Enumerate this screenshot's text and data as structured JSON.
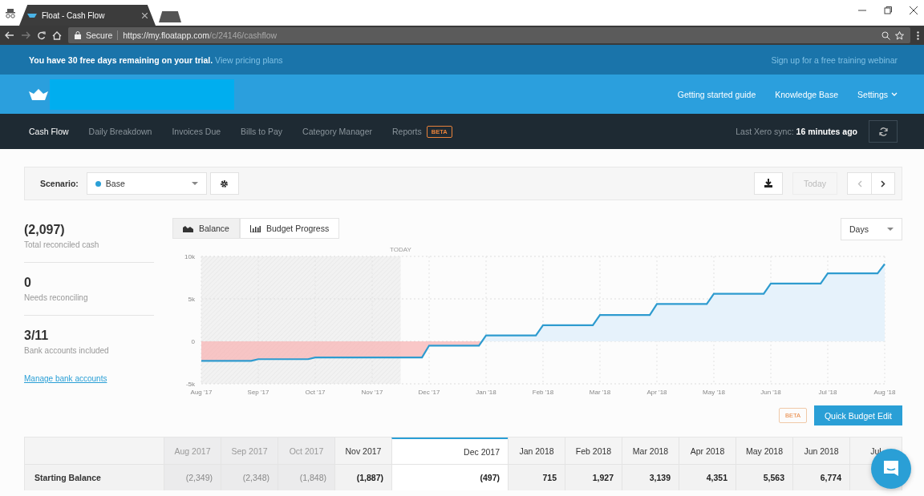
{
  "browser": {
    "tab_title": "Float - Cash Flow",
    "secure_label": "Secure",
    "url_host": "https://my.floatapp.com",
    "url_path": "/c/24146/cashflow"
  },
  "trial_banner": {
    "message": "You have 30 free days remaining on your trial.",
    "link": "View pricing plans",
    "right_link": "Sign up for a free training webinar"
  },
  "header": {
    "links": [
      {
        "label": "Getting started guide",
        "dropdown": false
      },
      {
        "label": "Knowledge Base",
        "dropdown": false
      },
      {
        "label": "Settings",
        "dropdown": true
      }
    ]
  },
  "nav": {
    "items": [
      {
        "label": "Cash Flow",
        "selected": true
      },
      {
        "label": "Daily Breakdown",
        "selected": false
      },
      {
        "label": "Invoices Due",
        "selected": false
      },
      {
        "label": "Bills to Pay",
        "selected": false
      },
      {
        "label": "Category Manager",
        "selected": false
      },
      {
        "label": "Reports",
        "selected": false,
        "badge": "BETA"
      }
    ],
    "sync_label": "Last Xero sync:",
    "sync_time": "16 minutes ago"
  },
  "toolbar": {
    "scenario_label": "Scenario:",
    "scenario": {
      "name": "Base",
      "color": "#2a9fd6"
    },
    "today_button": "Today",
    "today_disabled": true
  },
  "stats": [
    {
      "value": "(2,097)",
      "label": "Total reconciled cash"
    },
    {
      "value": "0",
      "label": "Needs reconciling"
    },
    {
      "value": "3/11",
      "label": "Bank accounts included"
    }
  ],
  "manage_link": "Manage bank accounts",
  "chart_tabs": [
    {
      "label": "Balance",
      "selected": true,
      "kind": "area"
    },
    {
      "label": "Budget Progress",
      "selected": false,
      "kind": "bars"
    }
  ],
  "period_select": "Days",
  "chart": {
    "today_label": "TODAY",
    "chart_data": {
      "type": "line",
      "grid": true,
      "categories": [
        "Aug '17",
        null,
        null,
        null,
        null,
        null,
        null,
        null,
        "Sep '17",
        null,
        null,
        null,
        null,
        null,
        null,
        null,
        "Oct '17",
        null,
        null,
        null,
        null,
        null,
        null,
        null,
        "Nov '17",
        null,
        null,
        null,
        null,
        null,
        null,
        null,
        "Dec '17",
        null,
        null,
        null,
        null,
        null,
        null,
        null,
        "Jan '18",
        null,
        null,
        null,
        null,
        null,
        null,
        null,
        "Feb '18",
        null,
        null,
        null,
        null,
        null,
        null,
        null,
        "Mar '18",
        null,
        null,
        null,
        null,
        null,
        null,
        null,
        "Apr '18",
        null,
        null,
        null,
        null,
        null,
        null,
        null,
        "May '18",
        null,
        null,
        null,
        null,
        null,
        null,
        null,
        "Jun '18",
        null,
        null,
        null,
        null,
        null,
        null,
        null,
        "Jul '18",
        null,
        null,
        null,
        null,
        null,
        null,
        null,
        "Aug '18"
      ],
      "ylim": [
        -5000,
        10000
      ],
      "yticks": [
        {
          "value": -5000,
          "label": "-5k"
        },
        {
          "value": 0,
          "label": "0"
        },
        {
          "value": 5000,
          "label": "5k"
        },
        {
          "value": 10000,
          "label": "10k"
        }
      ],
      "series": [
        {
          "color": "#2e9bcf",
          "values": [
            -2300,
            -2300,
            -2300,
            -2300,
            -2300,
            -2300,
            -2300,
            -2300,
            -2100,
            -2100,
            -2100,
            -2100,
            -2100,
            -2100,
            -2100,
            -2100,
            -1900,
            -1900,
            -1900,
            -1900,
            -1900,
            -1900,
            -1900,
            -1900,
            -1900,
            -1900,
            -1900,
            -1900,
            -1900,
            -1900,
            -1900,
            -1900,
            -500,
            -500,
            -500,
            -500,
            -500,
            -500,
            -500,
            -500,
            700,
            700,
            700,
            700,
            700,
            700,
            700,
            700,
            1900,
            1900,
            1900,
            1900,
            1900,
            1900,
            1900,
            1900,
            3100,
            3100,
            3100,
            3100,
            3100,
            3100,
            3100,
            3100,
            4400,
            4400,
            4400,
            4400,
            4400,
            4400,
            4400,
            4400,
            5600,
            5600,
            5600,
            5600,
            5600,
            5600,
            5600,
            5600,
            6800,
            6800,
            6800,
            6800,
            6800,
            6800,
            6800,
            6800,
            8000,
            8000,
            8000,
            8000,
            8000,
            8000,
            8000,
            8000,
            9100
          ]
        }
      ]
    }
  },
  "beta_badge": "BETA",
  "quick_edit_button": "Quick Budget Edit",
  "table": {
    "columns": [
      {
        "label": "Aug 2017",
        "kind": "past",
        "selected": false
      },
      {
        "label": "Sep 2017",
        "kind": "past",
        "selected": false
      },
      {
        "label": "Oct 2017",
        "kind": "past",
        "selected": false
      },
      {
        "label": "Nov 2017",
        "kind": "current",
        "selected": false
      },
      {
        "label": "Dec 2017",
        "kind": "future",
        "selected": true
      },
      {
        "label": "Jan 2018",
        "kind": "future",
        "selected": false
      },
      {
        "label": "Feb 2018",
        "kind": "future",
        "selected": false
      },
      {
        "label": "Mar 2018",
        "kind": "future",
        "selected": false
      },
      {
        "label": "Apr 2018",
        "kind": "future",
        "selected": false
      },
      {
        "label": "May 2018",
        "kind": "future",
        "selected": false
      },
      {
        "label": "Jun 2018",
        "kind": "future",
        "selected": false
      },
      {
        "label": "Jul",
        "kind": "future",
        "selected": false
      }
    ],
    "rows": [
      {
        "label": "Starting Balance",
        "cells": [
          "(2,349)",
          "(2,348)",
          "(1,848)",
          "(1,887)",
          "(497)",
          "715",
          "1,927",
          "3,139",
          "4,351",
          "5,563",
          "6,774"
        ]
      }
    ]
  }
}
